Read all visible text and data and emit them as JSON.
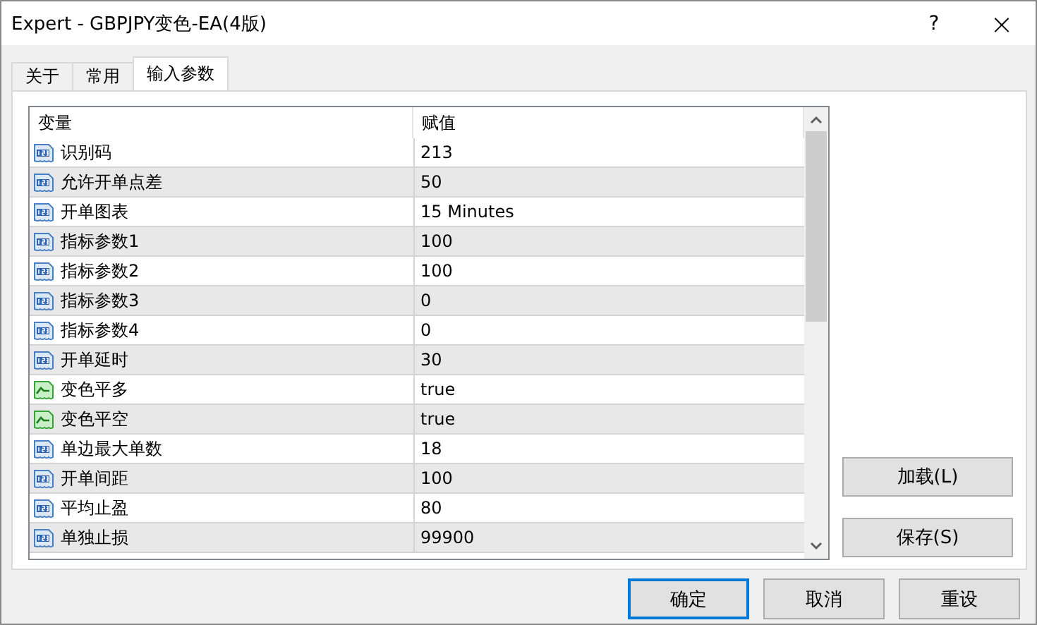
{
  "window": {
    "title": "Expert - GBPJPY变色-EA(4版)",
    "help": "?",
    "close": "×"
  },
  "tabs": [
    {
      "label": "关于",
      "selected": false
    },
    {
      "label": "常用",
      "selected": false
    },
    {
      "label": "输入参数",
      "selected": true
    }
  ],
  "table": {
    "columns": [
      "变量",
      "赋值"
    ],
    "rows": [
      {
        "kind": "number",
        "name": "识别码",
        "value": "213"
      },
      {
        "kind": "number",
        "name": "允许开单点差",
        "value": "50"
      },
      {
        "kind": "number",
        "name": "开单图表",
        "value": "15 Minutes"
      },
      {
        "kind": "number",
        "name": "指标参数1",
        "value": "100"
      },
      {
        "kind": "number",
        "name": "指标参数2",
        "value": "100"
      },
      {
        "kind": "number",
        "name": "指标参数3",
        "value": "0"
      },
      {
        "kind": "number",
        "name": "指标参数4",
        "value": "0"
      },
      {
        "kind": "number",
        "name": "开单延时",
        "value": "30"
      },
      {
        "kind": "bool",
        "name": "变色平多",
        "value": "true"
      },
      {
        "kind": "bool",
        "name": "变色平空",
        "value": "true"
      },
      {
        "kind": "number",
        "name": "单边最大单数",
        "value": "18"
      },
      {
        "kind": "number",
        "name": "开单间距",
        "value": "100"
      },
      {
        "kind": "number",
        "name": "平均止盈",
        "value": "80"
      },
      {
        "kind": "number",
        "name": "单独止损",
        "value": "99900"
      }
    ]
  },
  "side_buttons": [
    "加载(L)",
    "保存(S)"
  ],
  "buttons": [
    {
      "label": "确定",
      "default": true
    },
    {
      "label": "取消",
      "default": false
    },
    {
      "label": "重设",
      "default": false
    }
  ]
}
